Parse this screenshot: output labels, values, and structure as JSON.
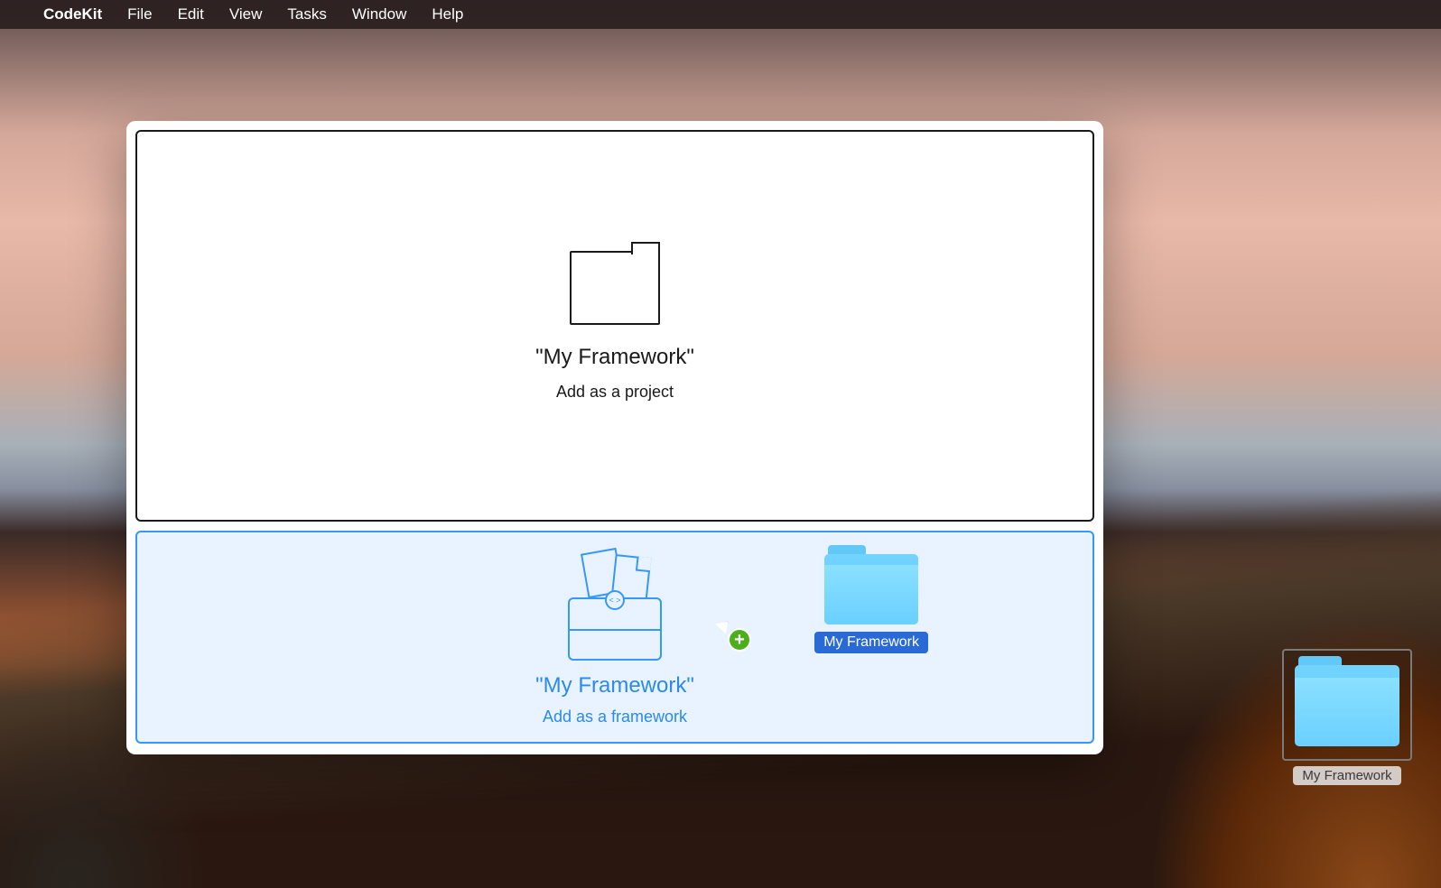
{
  "menubar": {
    "app_name": "CodeKit",
    "items": [
      "File",
      "Edit",
      "View",
      "Tasks",
      "Window",
      "Help"
    ]
  },
  "dropzones": {
    "project": {
      "title": "\"My Framework\"",
      "subtitle": "Add as a project"
    },
    "framework": {
      "title": "\"My Framework\"",
      "subtitle": "Add as a framework"
    }
  },
  "dragged_folder": {
    "label": "My Framework"
  },
  "desktop_folder": {
    "label": "My Framework"
  },
  "icons": {
    "toolbox_latch_glyph": "< >"
  },
  "colors": {
    "framework_accent": "#3498ff",
    "framework_bg": "#e8f3ff",
    "plus_badge": "#4caf1a",
    "folder_blue_top": "#8ae0ff",
    "folder_blue_bottom": "#6ad0ff"
  }
}
